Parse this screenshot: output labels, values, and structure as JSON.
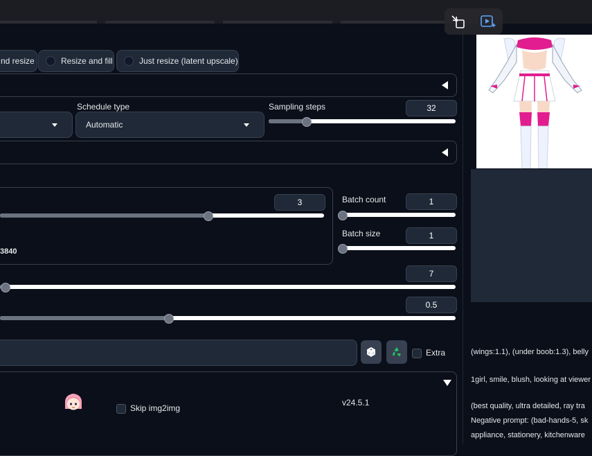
{
  "resize_modes": [
    {
      "label": "nd resize"
    },
    {
      "label": "Resize and fill"
    },
    {
      "label": "Just resize (latent upscale)"
    }
  ],
  "sampling": {
    "schedule_label": "Schedule type",
    "schedule_value": "Automatic",
    "steps_label": "Sampling steps",
    "steps_value": "32",
    "steps_fraction": 0.2
  },
  "dimensions": {
    "value": "3",
    "fraction": 0.64,
    "partial_text": "3840"
  },
  "batch": {
    "count_label": "Batch count",
    "count_value": "1",
    "size_label": "Batch size",
    "size_value": "1"
  },
  "cfg": {
    "value": "7",
    "fraction": 0.01
  },
  "denoise": {
    "value": "0.5",
    "fraction": 0.37
  },
  "seed": {
    "extra_label": "Extra"
  },
  "extension": {
    "skip_label": "Skip img2img",
    "version": "v24.5.1"
  },
  "info_text": {
    "line1": "(wings:1.1), (under boob:1.3), belly",
    "line2": "1girl, smile, blush, looking at viewer",
    "line3": "(best quality, ultra detailed, ray tra",
    "line4": "Negative prompt: (bad-hands-5, sk",
    "line5": "appliance, stationery, kitchenware"
  },
  "colors": {
    "background": "#0b0f19",
    "panel": "#1f2937",
    "border": "#374151",
    "accent_pink": "#e11d8f",
    "recycle_green": "#22c55e"
  }
}
